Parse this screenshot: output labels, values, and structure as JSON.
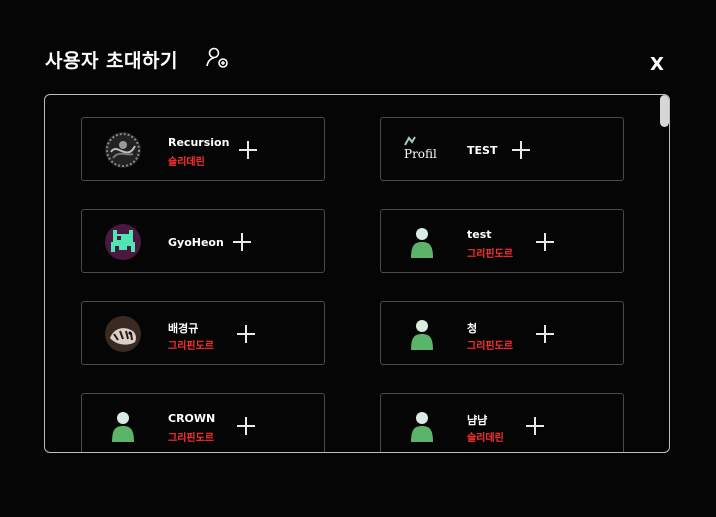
{
  "modal": {
    "title": "사용자 초대하기",
    "title_icon": "add-user-icon",
    "close_label": "X"
  },
  "users": [
    {
      "name": "Recursion",
      "team": "슬리데린",
      "avatar": "photo-avatar-icon"
    },
    {
      "name": "TEST",
      "team": "",
      "avatar": "broken-image-icon",
      "avatar_alt": "Profil"
    },
    {
      "name": "GyoHeon",
      "team": "",
      "avatar": "pixel-monster-avatar-icon"
    },
    {
      "name": "test",
      "team": "그리핀도르",
      "avatar": "default-user-icon"
    },
    {
      "name": "배경규",
      "team": "그리핀도르",
      "avatar": "photo-avatar-icon"
    },
    {
      "name": "청",
      "team": "그리핀도르",
      "avatar": "default-user-icon"
    },
    {
      "name": "CROWN",
      "team": "그리핀도르",
      "avatar": "default-user-icon"
    },
    {
      "name": "냠냠",
      "team": "슬리데린",
      "avatar": "default-user-icon"
    }
  ],
  "colors": {
    "team_text": "#ff3030",
    "default_avatar": "#5cb36a",
    "default_avatar_head": "#d9ece4"
  }
}
